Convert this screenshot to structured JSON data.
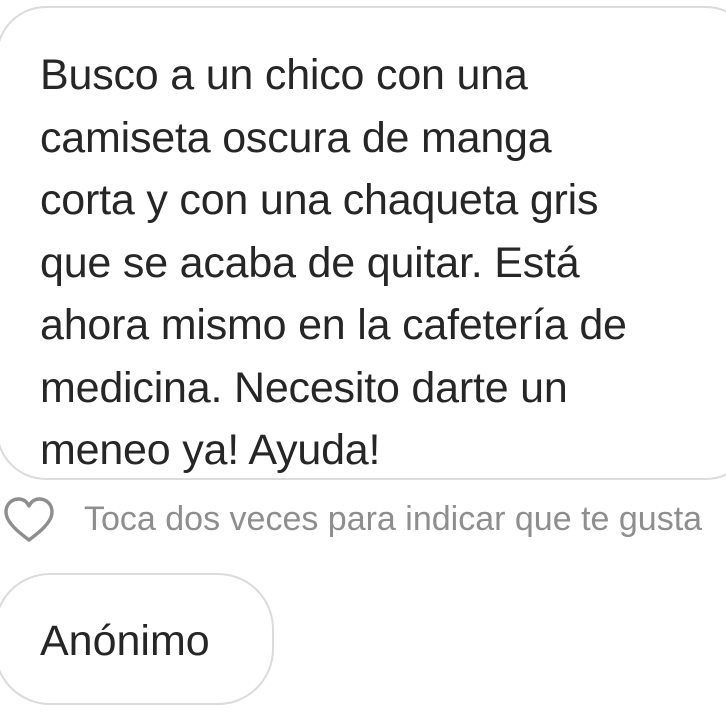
{
  "message": {
    "text": "Busco a un chico con una\ncamiseta oscura de manga\ncorta y con una chaqueta gris\nque se acaba de quitar. Está\nahora mismo en la cafetería de\nmedicina. Necesito darte un\nmeneo ya! Ayuda!"
  },
  "like": {
    "hint": "Toca dos veces para indicar que te gusta",
    "icon": "heart-outline-icon"
  },
  "sender": {
    "name": "Anónimo"
  },
  "colors": {
    "text": "#262626",
    "muted": "#8e8e8e",
    "border": "#dbdbdb",
    "background": "#ffffff"
  }
}
